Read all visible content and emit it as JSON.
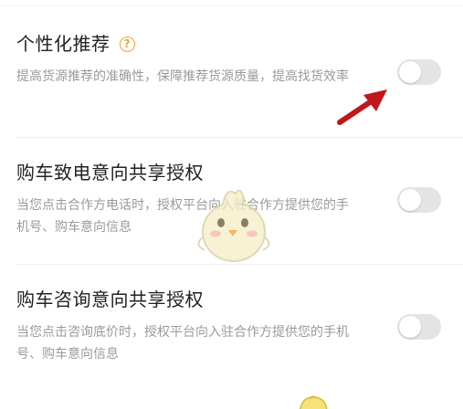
{
  "settings": {
    "items": [
      {
        "title": "个性化推荐",
        "help_icon": "question-circle-icon",
        "help_glyph": "?",
        "description": "提高货源推荐的准确性，保障推荐货源质量，提高找货效率",
        "enabled": false
      },
      {
        "title": "购车致电意向共享授权",
        "description": "当您点击合作方电话时，授权平台向入驻合作方提供您的手机号、购车意向信息",
        "enabled": false
      },
      {
        "title": "购车咨询意向共享授权",
        "description": "当您点击咨询底价时，授权平台向入驻合作方提供您的手机号、购车意向信息",
        "enabled": false
      }
    ]
  },
  "colors": {
    "title": "#222222",
    "description": "#9a9a9a",
    "toggle_off": "#e4e4e4",
    "help_icon": "#f2a33a",
    "annotation_arrow": "#c0161c"
  },
  "decorations": {
    "annotation": "red-arrow-icon",
    "watermark": "chick-mascot-icon"
  }
}
